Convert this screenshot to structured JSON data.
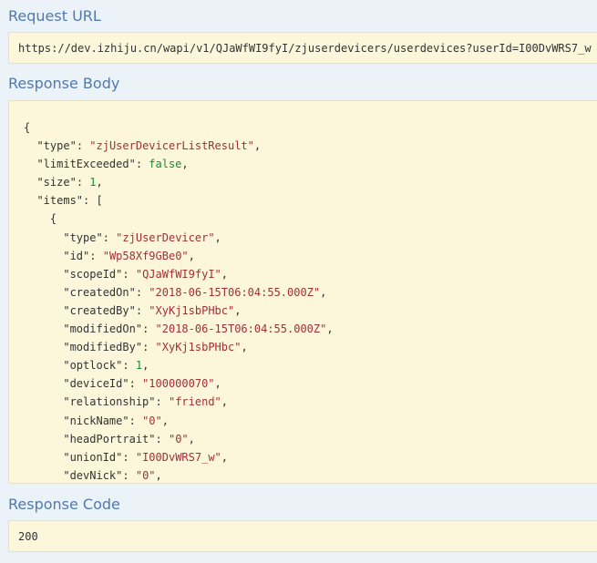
{
  "request_url": {
    "title": "Request URL",
    "value": "https://dev.izhiju.cn/wapi/v1/QJaWfWI9fyI/zjuserdevicers/userdevices?userId=I00DvWRS7_w"
  },
  "response_body": {
    "title": "Response Body",
    "lines": [
      {
        "indent": "",
        "key": "",
        "value": "",
        "vtype": "",
        "suffix": "{"
      },
      {
        "indent": "  ",
        "key": "\"type\"",
        "value": "\"zjUserDevicerListResult\"",
        "vtype": "s",
        "suffix": ","
      },
      {
        "indent": "  ",
        "key": "\"limitExceeded\"",
        "value": "false",
        "vtype": "b",
        "suffix": ","
      },
      {
        "indent": "  ",
        "key": "\"size\"",
        "value": "1",
        "vtype": "n",
        "suffix": ","
      },
      {
        "indent": "  ",
        "key": "\"items\"",
        "value": "",
        "vtype": "",
        "suffix": "["
      },
      {
        "indent": "    ",
        "key": "",
        "value": "",
        "vtype": "",
        "suffix": "{"
      },
      {
        "indent": "      ",
        "key": "\"type\"",
        "value": "\"zjUserDevicer\"",
        "vtype": "s",
        "suffix": ","
      },
      {
        "indent": "      ",
        "key": "\"id\"",
        "value": "\"Wp58Xf9GBe0\"",
        "vtype": "s",
        "suffix": ","
      },
      {
        "indent": "      ",
        "key": "\"scopeId\"",
        "value": "\"QJaWfWI9fyI\"",
        "vtype": "s",
        "suffix": ","
      },
      {
        "indent": "      ",
        "key": "\"createdOn\"",
        "value": "\"2018-06-15T06:04:55.000Z\"",
        "vtype": "s",
        "suffix": ","
      },
      {
        "indent": "      ",
        "key": "\"createdBy\"",
        "value": "\"XyKj1sbPHbc\"",
        "vtype": "s",
        "suffix": ","
      },
      {
        "indent": "      ",
        "key": "\"modifiedOn\"",
        "value": "\"2018-06-15T06:04:55.000Z\"",
        "vtype": "s",
        "suffix": ","
      },
      {
        "indent": "      ",
        "key": "\"modifiedBy\"",
        "value": "\"XyKj1sbPHbc\"",
        "vtype": "s",
        "suffix": ","
      },
      {
        "indent": "      ",
        "key": "\"optlock\"",
        "value": "1",
        "vtype": "n",
        "suffix": ","
      },
      {
        "indent": "      ",
        "key": "\"deviceId\"",
        "value": "\"100000070\"",
        "vtype": "s",
        "suffix": ","
      },
      {
        "indent": "      ",
        "key": "\"relationship\"",
        "value": "\"friend\"",
        "vtype": "s",
        "suffix": ","
      },
      {
        "indent": "      ",
        "key": "\"nickName\"",
        "value": "\"0\"",
        "vtype": "s",
        "suffix": ","
      },
      {
        "indent": "      ",
        "key": "\"headPortrait\"",
        "value": "\"0\"",
        "vtype": "s",
        "suffix": ","
      },
      {
        "indent": "      ",
        "key": "\"unionId\"",
        "value": "\"I00DvWRS7_w\"",
        "vtype": "s",
        "suffix": ","
      },
      {
        "indent": "      ",
        "key": "\"devNick\"",
        "value": "\"0\"",
        "vtype": "s",
        "suffix": ","
      }
    ]
  },
  "response_code": {
    "title": "Response Code",
    "value": "200"
  },
  "colors": {
    "title": "#4f7ab0",
    "box_background": "#fcf6db",
    "string": "#a0303a",
    "number": "#1c8a2e"
  }
}
